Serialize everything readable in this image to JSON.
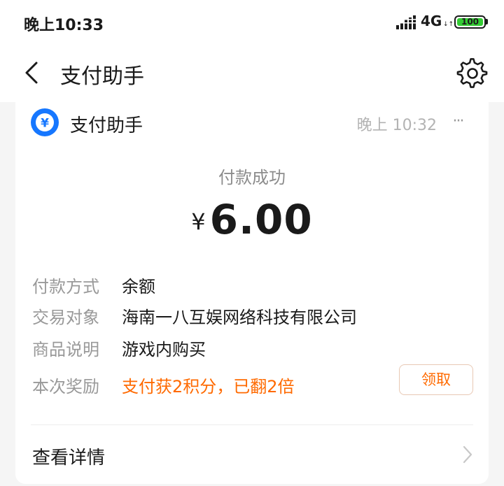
{
  "status_bar": {
    "time": "晚上10:33",
    "network": "4G",
    "arrows": "↓↑",
    "battery": "100"
  },
  "nav": {
    "title": "支付助手"
  },
  "card": {
    "app_name": "支付助手",
    "time": "晚上 10:32",
    "more": "···",
    "status": "付款成功",
    "currency": "¥",
    "amount": "6.00",
    "rows": [
      {
        "label": "付款方式",
        "value": "余额"
      },
      {
        "label": "交易对象",
        "value": "海南一八互娱网络科技有限公司"
      },
      {
        "label": "商品说明",
        "value": "游戏内购买"
      },
      {
        "label": "本次奖励",
        "value": "支付获2积分，已翻2倍"
      }
    ],
    "claim_label": "领取",
    "details_label": "查看详情"
  },
  "colors": {
    "accent_blue": "#1677ff",
    "reward_orange": "#ff6a00",
    "battery_green": "#33cc33"
  },
  "icons": {
    "back": "chevron-left-icon",
    "settings": "gear-icon",
    "app_logo": "yuan-coin-icon",
    "details": "chevron-right-icon",
    "signal": "signal-icon"
  }
}
